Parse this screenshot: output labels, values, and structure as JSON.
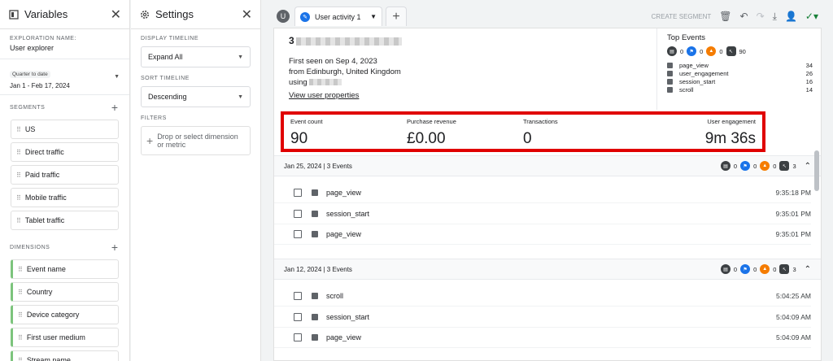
{
  "variables": {
    "title": "Variables",
    "exploration_label": "EXPLORATION NAME:",
    "exploration_name": "User explorer",
    "date_chip": "Quarter to date",
    "date_range": "Jan 1 - Feb 17, 2024",
    "segments_label": "SEGMENTS",
    "segments": [
      "US",
      "Direct traffic",
      "Paid traffic",
      "Mobile traffic",
      "Tablet traffic"
    ],
    "dimensions_label": "DIMENSIONS",
    "dimensions": [
      "Event name",
      "Country",
      "Device category",
      "First user medium",
      "Stream name"
    ]
  },
  "settings": {
    "title": "Settings",
    "display_timeline_label": "DISPLAY TIMELINE",
    "display_timeline": "Expand All",
    "sort_timeline_label": "SORT TIMELINE",
    "sort_timeline": "Descending",
    "filters_label": "FILTERS",
    "filter_placeholder": "Drop or select dimension or metric"
  },
  "tabs": {
    "user_badge": "U",
    "active_tab": "User activity 1",
    "create_segment": "CREATE SEGMENT"
  },
  "user": {
    "id_prefix": "3",
    "first_seen": "First seen on Sep 4, 2023",
    "location": "from Edinburgh, United Kingdom",
    "using": "using",
    "view_properties": "View user properties"
  },
  "top_events": {
    "title": "Top Events",
    "counts": [
      "0",
      "0",
      "0",
      "90"
    ],
    "events": [
      {
        "name": "page_view",
        "count": "34"
      },
      {
        "name": "user_engagement",
        "count": "26"
      },
      {
        "name": "session_start",
        "count": "16"
      },
      {
        "name": "scroll",
        "count": "14"
      }
    ]
  },
  "metrics": [
    {
      "label": "Event count",
      "value": "90"
    },
    {
      "label": "Purchase revenue",
      "value": "£0.00"
    },
    {
      "label": "Transactions",
      "value": "0"
    },
    {
      "label": "User engagement",
      "value": "9m 36s"
    }
  ],
  "groups": [
    {
      "date": "Jan 25, 2024 | 3 Events",
      "counts": [
        "0",
        "0",
        "0",
        "3"
      ],
      "events": [
        {
          "name": "page_view",
          "time": "9:35:18 PM"
        },
        {
          "name": "session_start",
          "time": "9:35:01 PM"
        },
        {
          "name": "page_view",
          "time": "9:35:01 PM"
        }
      ]
    },
    {
      "date": "Jan 12, 2024 | 3 Events",
      "counts": [
        "0",
        "0",
        "0",
        "3"
      ],
      "events": [
        {
          "name": "scroll",
          "time": "5:04:25 AM"
        },
        {
          "name": "session_start",
          "time": "5:04:09 AM"
        },
        {
          "name": "page_view",
          "time": "5:04:09 AM"
        }
      ]
    }
  ],
  "colors": {
    "accent": "#1a73e8",
    "highlight": "#e00000",
    "orange": "#f57c00"
  }
}
